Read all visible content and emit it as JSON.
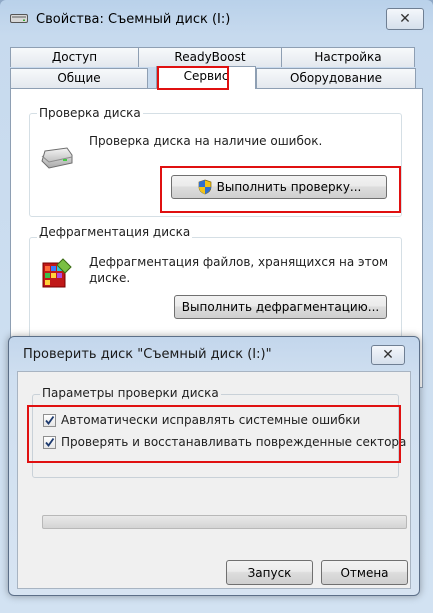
{
  "properties_window": {
    "title": "Свойства: Съемный диск (I:)",
    "close_glyph": "✕",
    "tabs_row_back": [
      "Доступ",
      "ReadyBoost",
      "Настройка"
    ],
    "tabs_row_front": [
      "Общие",
      "Сервис",
      "Оборудование"
    ],
    "active_tab": "Сервис",
    "check_group": {
      "title": "Проверка диска",
      "description": "Проверка диска на наличие ошибок.",
      "button_label": "Выполнить проверку..."
    },
    "defrag_group": {
      "title": "Дефрагментация диска",
      "description_line1": "Дефрагментация файлов, хранящихся на этом",
      "description_line2": "диске.",
      "button_label": "Выполнить дефрагментацию..."
    }
  },
  "check_dialog": {
    "title": "Проверить диск \"Съемный диск (I:)\"",
    "close_glyph": "✕",
    "group_title": "Параметры проверки диска",
    "options": [
      {
        "label": "Автоматически исправлять системные ошибки",
        "checked": true
      },
      {
        "label": "Проверять и восстанавливать поврежденные сектора",
        "checked": true
      }
    ],
    "progress": 0,
    "start_button": "Запуск",
    "cancel_button": "Отмена"
  },
  "colors": {
    "highlight": "#e01010",
    "titlebar": "#b9d1ea",
    "progress_fill": "#36b336"
  },
  "icons": [
    "drive-icon",
    "shield-icon",
    "defrag-icon",
    "close-icon",
    "checkmark-icon"
  ]
}
